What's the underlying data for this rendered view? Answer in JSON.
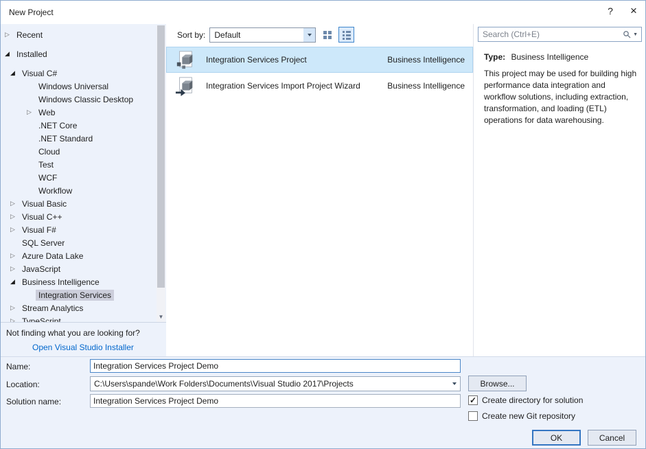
{
  "window": {
    "title": "New Project"
  },
  "icons": {
    "help": "?",
    "close": "×",
    "scroll_down": "▼",
    "expanded_arrow": "◢",
    "collapsed_arrow": "▷",
    "check": "✓"
  },
  "tree": {
    "items": [
      {
        "label": "Recent",
        "level": 0,
        "arrow": "collapsed",
        "selected": false,
        "top_group": true
      },
      {
        "label": "Installed",
        "level": 0,
        "arrow": "expanded",
        "selected": false,
        "top_group": true
      },
      {
        "label": "Visual C#",
        "level": 1,
        "arrow": "expanded",
        "selected": false
      },
      {
        "label": "Windows Universal",
        "level": 2,
        "arrow": "none",
        "selected": false
      },
      {
        "label": "Windows Classic Desktop",
        "level": 2,
        "arrow": "none",
        "selected": false
      },
      {
        "label": "Web",
        "level": 2,
        "arrow": "collapsed",
        "selected": false
      },
      {
        "label": ".NET Core",
        "level": 2,
        "arrow": "none",
        "selected": false
      },
      {
        "label": ".NET Standard",
        "level": 2,
        "arrow": "none",
        "selected": false
      },
      {
        "label": "Cloud",
        "level": 2,
        "arrow": "none",
        "selected": false
      },
      {
        "label": "Test",
        "level": 2,
        "arrow": "none",
        "selected": false
      },
      {
        "label": "WCF",
        "level": 2,
        "arrow": "none",
        "selected": false
      },
      {
        "label": "Workflow",
        "level": 2,
        "arrow": "none",
        "selected": false
      },
      {
        "label": "Visual Basic",
        "level": 1,
        "arrow": "collapsed",
        "selected": false
      },
      {
        "label": "Visual C++",
        "level": 1,
        "arrow": "collapsed",
        "selected": false
      },
      {
        "label": "Visual F#",
        "level": 1,
        "arrow": "collapsed",
        "selected": false
      },
      {
        "label": "SQL Server",
        "level": 1,
        "arrow": "none",
        "selected": false
      },
      {
        "label": "Azure Data Lake",
        "level": 1,
        "arrow": "collapsed",
        "selected": false
      },
      {
        "label": "JavaScript",
        "level": 1,
        "arrow": "collapsed",
        "selected": false
      },
      {
        "label": "Business Intelligence",
        "level": 1,
        "arrow": "expanded",
        "selected": false
      },
      {
        "label": "Integration Services",
        "level": 2,
        "arrow": "none",
        "selected": true
      },
      {
        "label": "Stream Analytics",
        "level": 1,
        "arrow": "collapsed",
        "selected": false
      },
      {
        "label": "TypeScript",
        "level": 1,
        "arrow": "collapsed",
        "selected": false
      }
    ],
    "footer_question": "Not finding what you are looking for?",
    "installer_link": "Open Visual Studio Installer"
  },
  "toolbar": {
    "sort_by_label": "Sort by:",
    "sort_value": "Default"
  },
  "search": {
    "placeholder": "Search (Ctrl+E)"
  },
  "templates": [
    {
      "name": "Integration Services Project",
      "category": "Business Intelligence",
      "selected": true
    },
    {
      "name": "Integration Services Import Project Wizard",
      "category": "Business Intelligence",
      "selected": false
    }
  ],
  "details": {
    "type_label": "Type:",
    "type_value": "Business Intelligence",
    "description": "This project may be used for building high performance data integration and workflow solutions, including extraction, transformation, and loading (ETL) operations for data warehousing."
  },
  "form": {
    "name_label": "Name:",
    "name_value": "Integration Services Project Demo",
    "location_label": "Location:",
    "location_value": "C:\\Users\\spande\\Work Folders\\Documents\\Visual Studio 2017\\Projects",
    "browse_label": "Browse...",
    "solution_label": "Solution name:",
    "solution_value": "Integration Services Project Demo",
    "create_dir_label": "Create directory for solution",
    "create_dir_checked": true,
    "git_label": "Create new Git repository",
    "git_checked": false,
    "ok_label": "OK",
    "cancel_label": "Cancel"
  },
  "colors": {
    "accent": "#3576c2",
    "link": "#0066cc",
    "tree_selection": "#cccedb",
    "template_selection": "#cde8fa",
    "panel_background": "#edf2fb"
  }
}
